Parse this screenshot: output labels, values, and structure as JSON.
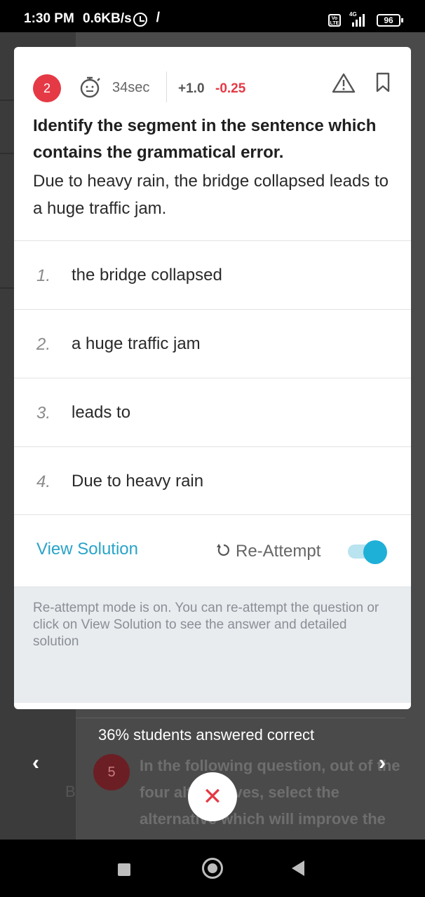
{
  "status_bar": {
    "time": "1:30 PM",
    "speed": "0.6KB/s",
    "volte": "Vo LTE",
    "network": "4G",
    "battery": "96",
    "icons": [
      "alarm-icon",
      "dnd-icon",
      "volte-icon",
      "signal-icon",
      "battery-icon"
    ]
  },
  "question": {
    "number": "2",
    "time": "34sec",
    "marks_positive": "+1.0",
    "marks_negative": "-0.25",
    "instruction": "Identify the segment in the sentence which contains the grammatical error.",
    "sentence": "Due to heavy rain, the bridge collapsed leads to a huge traffic jam."
  },
  "options": [
    {
      "num": "1.",
      "text": "the bridge collapsed"
    },
    {
      "num": "2.",
      "text": "a huge traffic jam"
    },
    {
      "num": "3.",
      "text": "leads to"
    },
    {
      "num": "4.",
      "text": "Due to heavy rain"
    }
  ],
  "actions": {
    "view_solution": "View Solution",
    "reattempt": "Re-Attempt",
    "reattempt_on": true
  },
  "info": "Re-attempt mode is on. You can re-attempt the question or click on View Solution to see the answer and detailed solution",
  "background": {
    "stat": "36% students answered correct",
    "next_number": "5",
    "next_text": "In the following question, out of the four alternatives, select the alternative which will improve the",
    "side_letter": "B"
  },
  "nav": {
    "prev": "‹",
    "next": "›",
    "close": "✕"
  },
  "colors": {
    "accent": "#29a3c9",
    "danger": "#e53945",
    "toggle_on": "#1fb0d8"
  }
}
